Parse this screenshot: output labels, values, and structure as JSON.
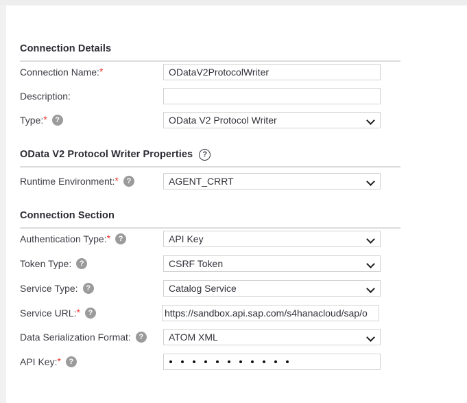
{
  "sections": [
    {
      "title": "Connection Details",
      "help": false
    },
    {
      "title": "OData V2 Protocol Writer Properties",
      "help": true,
      "help_glyph": "?"
    },
    {
      "title": "Connection Section",
      "help": false
    }
  ],
  "help_glyph": "?",
  "required_marker": "*",
  "fields": [
    {
      "label": "Connection Name:",
      "required": true,
      "has_help": false,
      "control": "text",
      "value": "ODataV2ProtocolWriter"
    },
    {
      "label": "Description:",
      "required": false,
      "has_help": false,
      "control": "text",
      "value": ""
    },
    {
      "label": "Type:",
      "required": true,
      "has_help": true,
      "control": "select",
      "value": "OData V2 Protocol Writer"
    },
    {
      "label": "Runtime Environment:",
      "required": true,
      "has_help": true,
      "control": "select",
      "value": "AGENT_CRRT"
    },
    {
      "label": "Authentication Type:",
      "required": true,
      "has_help": true,
      "control": "select",
      "value": "API Key"
    },
    {
      "label": "Token Type:",
      "required": false,
      "has_help": true,
      "control": "select",
      "value": "CSRF Token"
    },
    {
      "label": "Service Type:",
      "required": false,
      "has_help": true,
      "control": "select",
      "value": "Catalog Service"
    },
    {
      "label": "Service URL:",
      "required": true,
      "has_help": true,
      "control": "url",
      "value": "https://sandbox.api.sap.com/s4hanacloud/sap/o"
    },
    {
      "label": "Data Serialization Format:",
      "required": false,
      "has_help": true,
      "control": "select",
      "value": "ATOM XML"
    },
    {
      "label": "API Key:",
      "required": true,
      "has_help": true,
      "control": "password",
      "value": "",
      "masked_char_count": 11
    }
  ],
  "colors": {
    "required_star": "#e8322a",
    "label_text": "#3c3c44",
    "section_title": "#2b2b33",
    "field_border": "#d2d2d2",
    "rule": "#dcdcdc",
    "help_icon_fill": "#9b9b9b",
    "page_background": "#ffffff",
    "chrome_gray": "#eeeeee"
  }
}
